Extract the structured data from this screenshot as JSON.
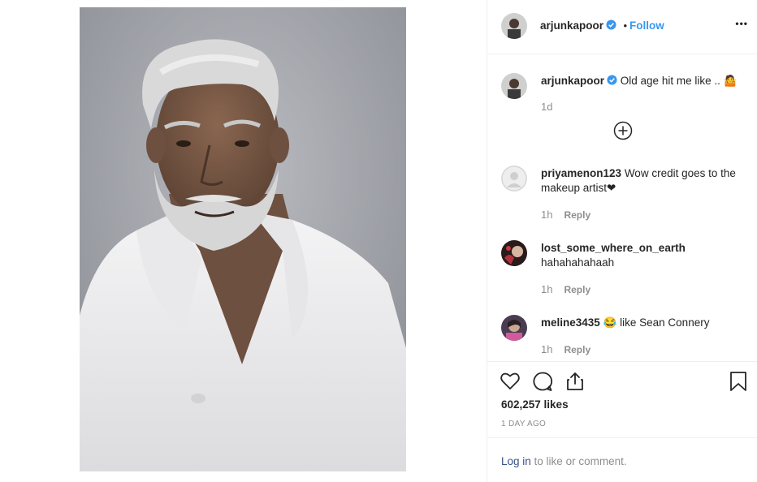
{
  "post": {
    "author": "arjunkapoor",
    "follow_dot": "•",
    "follow_label": "Follow",
    "more_label": "•••",
    "caption_author": "arjunkapoor",
    "caption_text": "Old age hit me like .. 🤷",
    "caption_time": "1d",
    "likes": "602,257 likes",
    "date": "1 DAY AGO",
    "login_link": "Log in",
    "login_rest": " to like or comment."
  },
  "comments": [
    {
      "user": "priyamenon123",
      "text": "Wow credit goes to the makeup artist❤",
      "time": "1h",
      "reply_label": "Reply"
    },
    {
      "user": "lost_some_where_on_earth",
      "text": "hahahahahaah",
      "time": "1h",
      "reply_label": "Reply"
    },
    {
      "user": "meline3435",
      "text": "😂 like Sean Connery",
      "time": "1h",
      "reply_label": "Reply"
    }
  ],
  "colors": {
    "link_blue": "#3897f0",
    "verified_blue": "#3897f0",
    "text_gray": "#8e8e8e"
  },
  "icons": [
    "verified-badge-icon",
    "more-options-icon",
    "load-more-comments-icon",
    "heart-icon",
    "comment-icon",
    "share-icon",
    "bookmark-icon"
  ]
}
